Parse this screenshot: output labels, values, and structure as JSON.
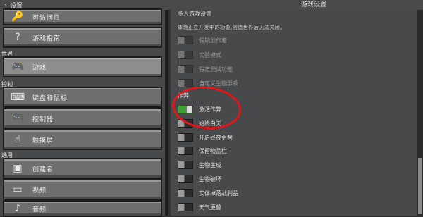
{
  "topbar": {
    "back_label": "设置",
    "title": "游戏设置"
  },
  "left": {
    "items_top": [
      {
        "name": "nav-item-accessibility",
        "icon": "key-icon",
        "glyph": "🔑",
        "label": "可访问性"
      },
      {
        "name": "nav-item-game-guide",
        "icon": "question-icon",
        "glyph": "?",
        "label": "游戏指南"
      }
    ],
    "section_general": "世界",
    "game_item": {
      "icon": "controller-icon",
      "glyph": "🎮",
      "label": "游戏"
    },
    "section_controls": "控制",
    "control_items": [
      {
        "name": "nav-item-keyboard-mouse",
        "icon": "keyboard-icon",
        "glyph": "⌨",
        "label": "键盘和鼠标"
      },
      {
        "name": "nav-item-controller",
        "icon": "controller-icon",
        "glyph": "🎮",
        "label": "控制器"
      },
      {
        "name": "nav-item-touch",
        "icon": "touch-icon",
        "glyph": "☝",
        "label": "触摸屏"
      }
    ],
    "section_general2": "通用",
    "general_items": [
      {
        "name": "nav-item-creator",
        "icon": "creator-icon",
        "glyph": "▣",
        "label": "创建者"
      },
      {
        "name": "nav-item-video",
        "icon": "monitor-icon",
        "glyph": "▭",
        "label": "视频"
      },
      {
        "name": "nav-item-audio",
        "icon": "speaker-icon",
        "glyph": "♪",
        "label": "音频"
      }
    ]
  },
  "right": {
    "top_header": "多人游戏设置",
    "note": "体验正在开发中的功能,创造世界后无法关闭。",
    "experimental": [
      {
        "label": "假期创作者",
        "on": false
      },
      {
        "label": "实验模式",
        "on": false
      },
      {
        "label": "假定测试功能",
        "on": false
      },
      {
        "label": "自定义生物群系",
        "on": false
      }
    ],
    "cheats_header": "作弊",
    "cheats": [
      {
        "label": "激活作弊",
        "on": true
      },
      {
        "label": "始终白天",
        "on": false
      },
      {
        "label": "开启昼夜更替",
        "on": false
      },
      {
        "label": "保留物品栏",
        "on": false
      },
      {
        "label": "生物生成",
        "on": false
      },
      {
        "label": "生物破坏",
        "on": false
      },
      {
        "label": "实体掉落战利品",
        "on": false
      },
      {
        "label": "天气更替",
        "on": false
      }
    ]
  },
  "colors": {
    "accent_green": "#3e9f34",
    "annotation_red": "#e0161a",
    "panel": "#48494a"
  }
}
